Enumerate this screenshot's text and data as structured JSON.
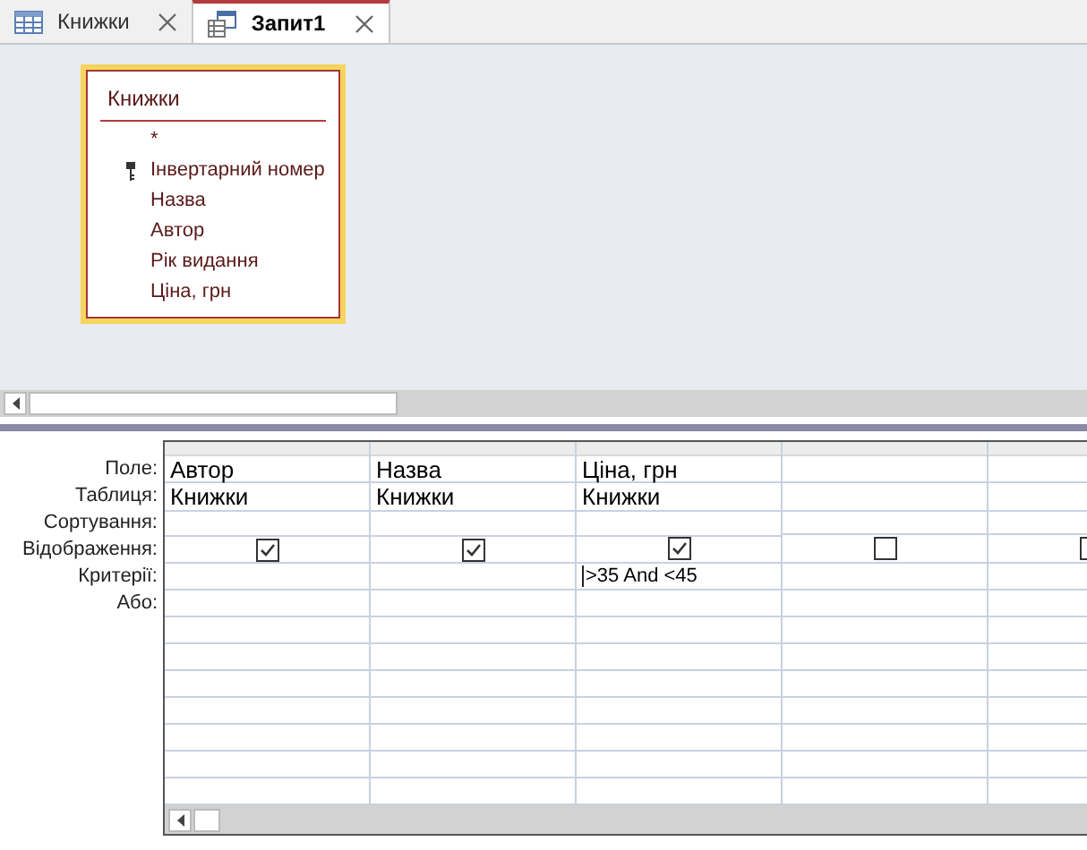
{
  "tabs": [
    {
      "label": "Книжки",
      "kind": "table",
      "selected": false
    },
    {
      "label": "Запит1",
      "kind": "query",
      "selected": true
    }
  ],
  "field_list": {
    "title": "Книжки",
    "fields": [
      {
        "name": "*",
        "primary_key": false
      },
      {
        "name": "Інвертарний номер",
        "primary_key": true
      },
      {
        "name": "Назва",
        "primary_key": false
      },
      {
        "name": "Автор",
        "primary_key": false
      },
      {
        "name": "Рік видання",
        "primary_key": false
      },
      {
        "name": "Ціна, грн",
        "primary_key": false
      }
    ]
  },
  "grid": {
    "row_labels": [
      "Поле:",
      "Таблиця:",
      "Сортування:",
      "Відображення:",
      "Критерії:",
      "Або:"
    ],
    "columns": [
      {
        "field": "Автор",
        "table": "Книжки",
        "show": true
      },
      {
        "field": "Назва",
        "table": "Книжки",
        "show": true
      },
      {
        "field": "Ціна, грн",
        "table": "Книжки",
        "show": true,
        "criteria": ">35 And <45"
      },
      {
        "show": false
      },
      {
        "show": false
      }
    ]
  }
}
